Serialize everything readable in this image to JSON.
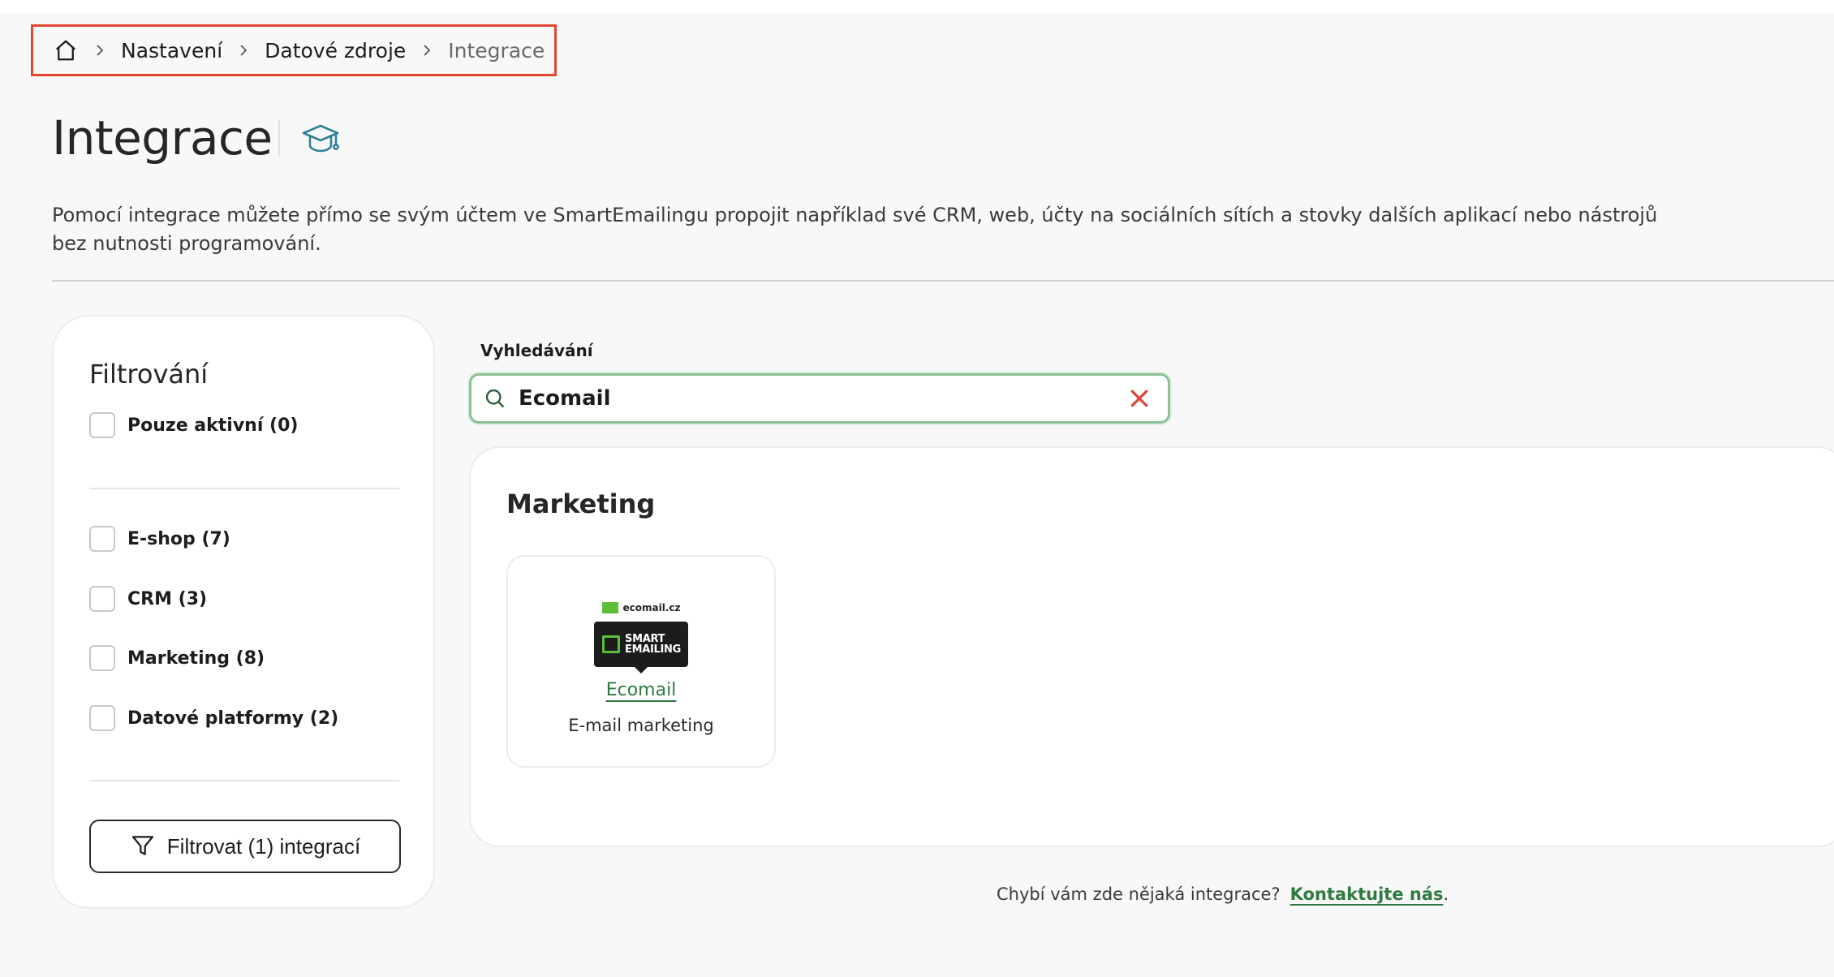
{
  "breadcrumb": {
    "home_icon": "home-icon",
    "items": [
      {
        "label": "Nastavení"
      },
      {
        "label": "Datové zdroje"
      },
      {
        "label": "Integrace"
      }
    ]
  },
  "page": {
    "title": "Integrace",
    "academy_icon": "graduation-cap-icon",
    "intro": "Pomocí integrace můžete přímo se svým účtem ve SmartEmailingu propojit například své CRM, web, účty na sociálních sítích a stovky dalších aplikací nebo nástrojů bez nutnosti programování."
  },
  "filters": {
    "title": "Filtrování",
    "only_active": {
      "label": "Pouze aktivní (0)",
      "checked": false
    },
    "categories": [
      {
        "label": "E-shop (7)",
        "checked": false
      },
      {
        "label": "CRM (3)",
        "checked": false
      },
      {
        "label": "Marketing (8)",
        "checked": false
      },
      {
        "label": "Datové platformy (2)",
        "checked": false
      }
    ],
    "button_label": "Filtrovat (1) integrací",
    "button_icon": "filter-icon"
  },
  "search": {
    "label": "Vyhledávání",
    "value": "Ecomail",
    "icon": "search-icon",
    "clear_icon": "close-icon"
  },
  "results": {
    "section_title": "Marketing",
    "cards": [
      {
        "logo_domain": "ecomail.cz",
        "logo_text_1": "SMART",
        "logo_text_2": "EMAILING",
        "name": "Ecomail",
        "description": "E-mail marketing"
      }
    ]
  },
  "footer": {
    "question": "Chybí vám zde nějaká integrace?",
    "link": "Kontaktujte nás",
    "suffix": "."
  },
  "colors": {
    "accent_green": "#2f7a41",
    "highlight_border": "#e2462e",
    "academy_icon": "#2f7f9a",
    "clear_icon": "#d9433a"
  }
}
